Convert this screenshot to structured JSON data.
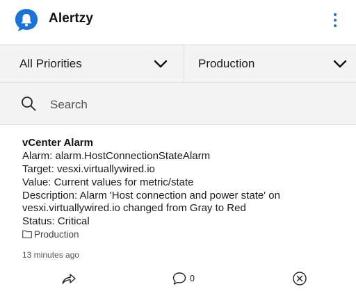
{
  "app": {
    "title": "Alertzy",
    "logo_icon": "chat-bell-icon",
    "accent_color": "#1a73d9"
  },
  "filters": {
    "priority": {
      "selected": "All Priorities",
      "icon": "chevron-down-icon"
    },
    "environment": {
      "selected": "Production",
      "icon": "chevron-down-icon"
    }
  },
  "search": {
    "placeholder": "Search",
    "value": "",
    "icon": "search-icon"
  },
  "alerts": [
    {
      "title": "vCenter Alarm",
      "lines": [
        "Alarm: alarm.HostConnectionStateAlarm",
        "Target: vesxi.virtuallywired.io",
        "Value: Current values for metric/state",
        "Description: Alarm 'Host connection and power state' on",
        "vesxi.virtuallywired.io changed from Gray to Red",
        "Status: Critical"
      ],
      "group": "Production",
      "time_ago": "13 minutes ago",
      "comment_count": "0"
    }
  ]
}
